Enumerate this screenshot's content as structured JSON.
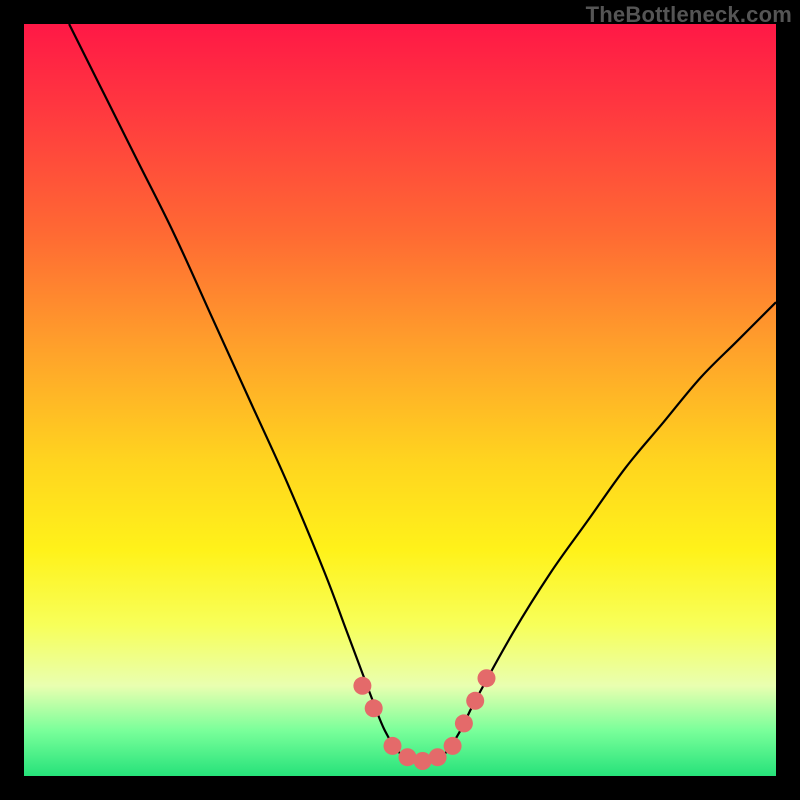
{
  "watermark": "TheBottleneck.com",
  "chart_data": {
    "type": "line",
    "title": "",
    "xlabel": "",
    "ylabel": "",
    "xlim": [
      0,
      100
    ],
    "ylim": [
      0,
      100
    ],
    "grid": false,
    "legend": false,
    "series": [
      {
        "name": "bottleneck-curve",
        "x": [
          6,
          10,
          15,
          20,
          25,
          30,
          35,
          40,
          43,
          46,
          48,
          50,
          52,
          54,
          56,
          58,
          60,
          65,
          70,
          75,
          80,
          85,
          90,
          95,
          100
        ],
        "y": [
          100,
          92,
          82,
          72,
          61,
          50,
          39,
          27,
          19,
          11,
          6,
          3,
          2,
          2,
          3,
          6,
          10,
          19,
          27,
          34,
          41,
          47,
          53,
          58,
          63
        ]
      }
    ],
    "markers": {
      "name": "highlight-dots",
      "x": [
        45,
        46.5,
        49,
        51,
        53,
        55,
        57,
        58.5,
        60,
        61.5
      ],
      "y": [
        12,
        9,
        4,
        2.5,
        2,
        2.5,
        4,
        7,
        10,
        13
      ]
    },
    "gradient_stops": [
      {
        "pos": 0.0,
        "color": "#ff1846"
      },
      {
        "pos": 0.28,
        "color": "#ff6a33"
      },
      {
        "pos": 0.58,
        "color": "#ffd41f"
      },
      {
        "pos": 0.8,
        "color": "#f7ff5a"
      },
      {
        "pos": 0.94,
        "color": "#79ff9a"
      },
      {
        "pos": 1.0,
        "color": "#26e27a"
      }
    ]
  }
}
